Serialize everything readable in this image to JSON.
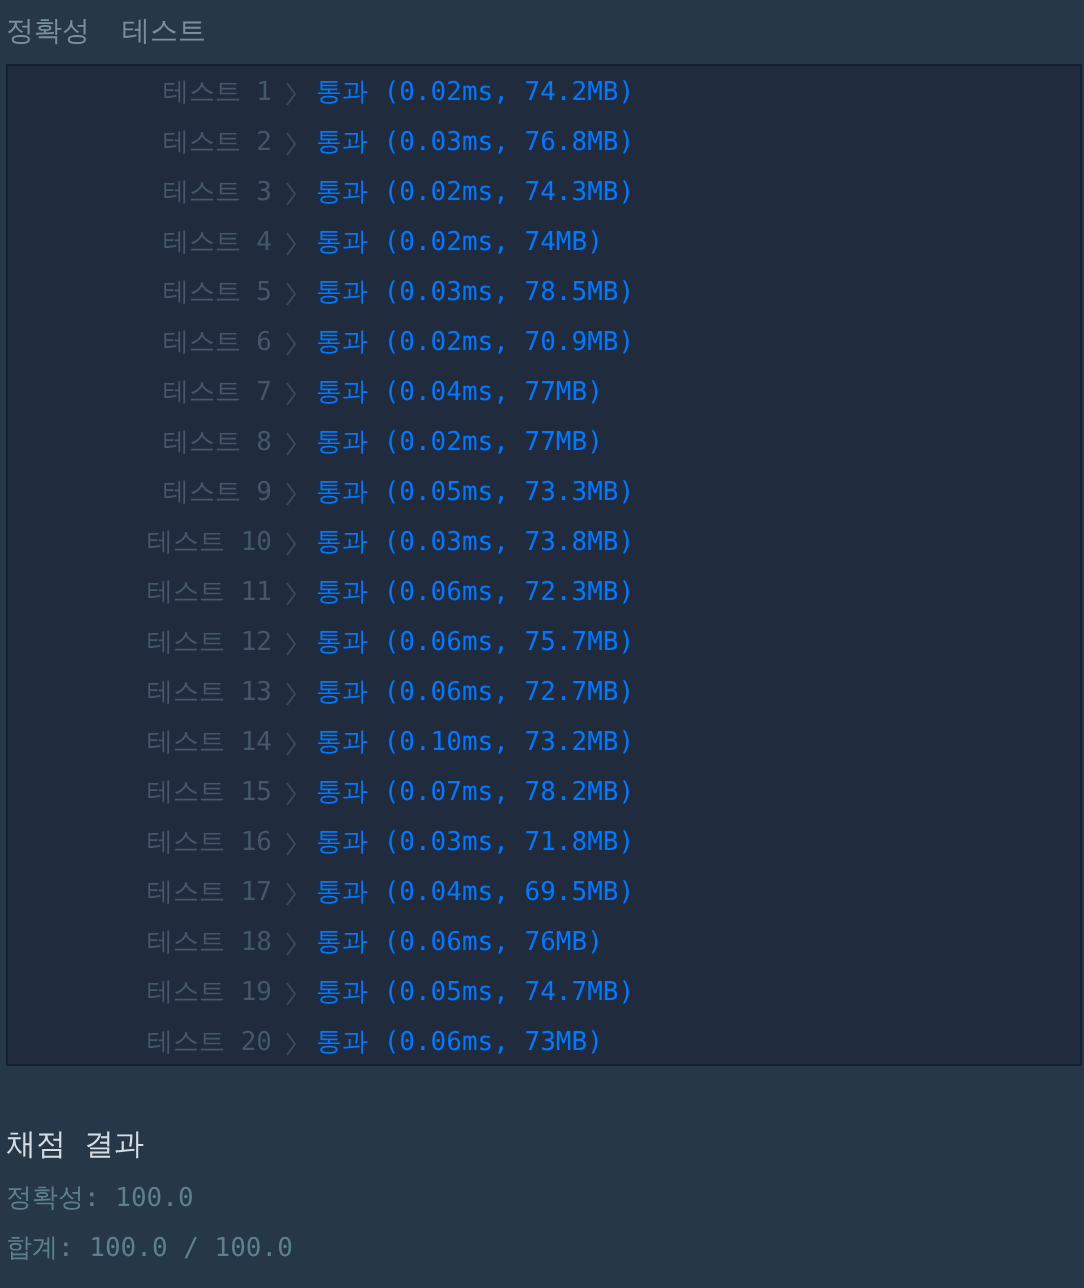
{
  "tabs": [
    {
      "label": "정확성"
    },
    {
      "label": "테스트"
    }
  ],
  "results": [
    {
      "label": "테스트 1",
      "status": "통과",
      "detail": "(0.02ms, 74.2MB)",
      "passed": true
    },
    {
      "label": "테스트 2",
      "status": "통과",
      "detail": "(0.03ms, 76.8MB)",
      "passed": true
    },
    {
      "label": "테스트 3",
      "status": "통과",
      "detail": "(0.02ms, 74.3MB)",
      "passed": true
    },
    {
      "label": "테스트 4",
      "status": "통과",
      "detail": "(0.02ms, 74MB)",
      "passed": true
    },
    {
      "label": "테스트 5",
      "status": "통과",
      "detail": "(0.03ms, 78.5MB)",
      "passed": true
    },
    {
      "label": "테스트 6",
      "status": "통과",
      "detail": "(0.02ms, 70.9MB)",
      "passed": true
    },
    {
      "label": "테스트 7",
      "status": "통과",
      "detail": "(0.04ms, 77MB)",
      "passed": true
    },
    {
      "label": "테스트 8",
      "status": "통과",
      "detail": "(0.02ms, 77MB)",
      "passed": true
    },
    {
      "label": "테스트 9",
      "status": "통과",
      "detail": "(0.05ms, 73.3MB)",
      "passed": true
    },
    {
      "label": "테스트 10",
      "status": "통과",
      "detail": "(0.03ms, 73.8MB)",
      "passed": true
    },
    {
      "label": "테스트 11",
      "status": "통과",
      "detail": "(0.06ms, 72.3MB)",
      "passed": true
    },
    {
      "label": "테스트 12",
      "status": "통과",
      "detail": "(0.06ms, 75.7MB)",
      "passed": true
    },
    {
      "label": "테스트 13",
      "status": "통과",
      "detail": "(0.06ms, 72.7MB)",
      "passed": true
    },
    {
      "label": "테스트 14",
      "status": "통과",
      "detail": "(0.10ms, 73.2MB)",
      "passed": true
    },
    {
      "label": "테스트 15",
      "status": "통과",
      "detail": "(0.07ms, 78.2MB)",
      "passed": true
    },
    {
      "label": "테스트 16",
      "status": "통과",
      "detail": "(0.03ms, 71.8MB)",
      "passed": true
    },
    {
      "label": "테스트 17",
      "status": "통과",
      "detail": "(0.04ms, 69.5MB)",
      "passed": true
    },
    {
      "label": "테스트 18",
      "status": "통과",
      "detail": "(0.06ms, 76MB)",
      "passed": true
    },
    {
      "label": "테스트 19",
      "status": "통과",
      "detail": "(0.05ms, 74.7MB)",
      "passed": true
    },
    {
      "label": "테스트 20",
      "status": "통과",
      "detail": "(0.06ms, 73MB)",
      "passed": true
    }
  ],
  "summary": {
    "title": "채점 결과",
    "lines": [
      "정확성: 100.0",
      "합계: 100.0 / 100.0"
    ]
  }
}
